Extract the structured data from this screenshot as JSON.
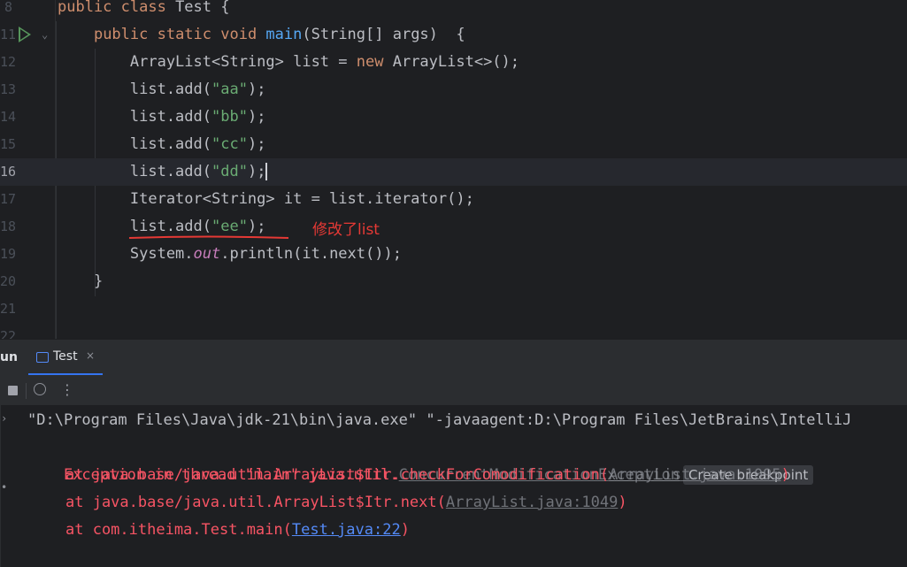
{
  "editor": {
    "lines": [
      {
        "num": "8",
        "tokens": [
          {
            "t": "public class ",
            "c": "kw"
          },
          {
            "t": "Test {",
            "c": ""
          }
        ]
      },
      {
        "num": "11",
        "tokens": [
          {
            "t": "    ",
            "c": ""
          },
          {
            "t": "public static void ",
            "c": "kw"
          },
          {
            "t": "main",
            "c": "fn"
          },
          {
            "t": "(String[] args)  {",
            "c": ""
          }
        ]
      },
      {
        "num": "12",
        "tokens": [
          {
            "t": "        ArrayList<String> list = ",
            "c": ""
          },
          {
            "t": "new ",
            "c": "kw"
          },
          {
            "t": "ArrayList<>();",
            "c": ""
          }
        ]
      },
      {
        "num": "13",
        "tokens": [
          {
            "t": "        list.add(",
            "c": ""
          },
          {
            "t": "\"aa\"",
            "c": "str"
          },
          {
            "t": ");",
            "c": ""
          }
        ]
      },
      {
        "num": "14",
        "tokens": [
          {
            "t": "        list.add(",
            "c": ""
          },
          {
            "t": "\"bb\"",
            "c": "str"
          },
          {
            "t": ");",
            "c": ""
          }
        ]
      },
      {
        "num": "15",
        "tokens": [
          {
            "t": "        list.add(",
            "c": ""
          },
          {
            "t": "\"cc\"",
            "c": "str"
          },
          {
            "t": ");",
            "c": ""
          }
        ]
      },
      {
        "num": "16",
        "tokens": [
          {
            "t": "        list.add(",
            "c": ""
          },
          {
            "t": "\"dd\"",
            "c": "str"
          },
          {
            "t": ");",
            "c": ""
          }
        ],
        "current": true
      },
      {
        "num": "17",
        "tokens": [
          {
            "t": "        Iterator<String> it = list.iterator();",
            "c": ""
          }
        ]
      },
      {
        "num": "18",
        "tokens": [
          {
            "t": "        list.add(",
            "c": ""
          },
          {
            "t": "\"ee\"",
            "c": "str"
          },
          {
            "t": ");",
            "c": ""
          }
        ]
      },
      {
        "num": "19",
        "tokens": [
          {
            "t": "        System.",
            "c": ""
          },
          {
            "t": "out",
            "c": "fld"
          },
          {
            "t": ".println(it.next());",
            "c": ""
          }
        ]
      },
      {
        "num": "20",
        "tokens": [
          {
            "t": "    }",
            "c": ""
          }
        ]
      },
      {
        "num": "21",
        "tokens": []
      },
      {
        "num": "22",
        "tokens": []
      }
    ],
    "annotation": "修改了list"
  },
  "tool_window": {
    "title": "un",
    "tab_label": "Test",
    "tab_close": "×"
  },
  "console": {
    "cmd_line": "\"D:\\Program Files\\Java\\jdk-21\\bin\\java.exe\" \"-javaagent:D:\\Program Files\\JetBrains\\IntelliJ",
    "exception_prefix": "Exception in thread \"main\" java.util.",
    "exception_name": "ConcurrentModificationException",
    "create_breakpoint": "Create breakpoint",
    "stack": [
      {
        "prefix": "at java.base/java.util.ArrayList$Itr.checkForComodification(",
        "link": "ArrayList.java:1095",
        "suffix": ")",
        "blue": false
      },
      {
        "prefix": "at java.base/java.util.ArrayList$Itr.next(",
        "link": "ArrayList.java:1049",
        "suffix": ")",
        "blue": false
      },
      {
        "prefix": "at com.itheima.Test.main(",
        "link": "Test.java:22",
        "suffix": ")",
        "blue": true
      }
    ]
  },
  "colors": {
    "keyword": "#cf8e6d",
    "method": "#56a8f5",
    "string": "#6aab73",
    "error": "#f75464",
    "annotation": "#e53935"
  }
}
